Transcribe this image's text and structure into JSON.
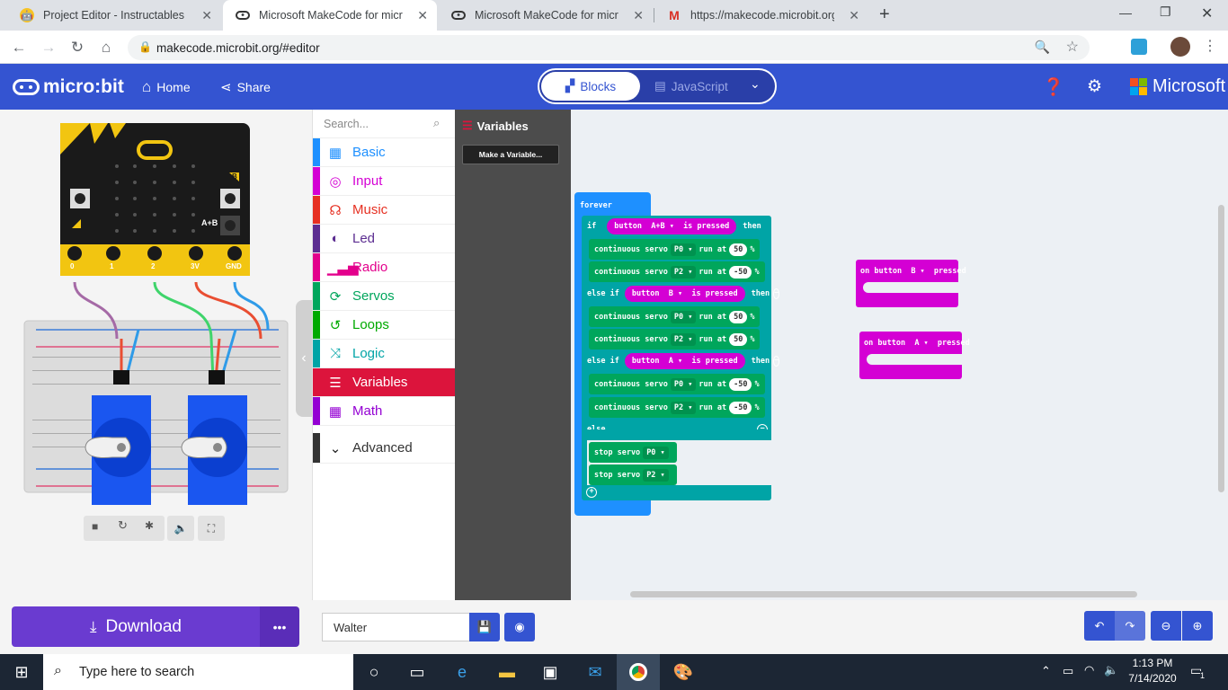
{
  "browser": {
    "tabs": [
      {
        "title": "Project Editor - Instructables",
        "active": false
      },
      {
        "title": "Microsoft MakeCode for micro:bi",
        "active": true
      },
      {
        "title": "Microsoft MakeCode for micro:bi",
        "active": false
      },
      {
        "title": "https://makecode.microbit.org/_l",
        "active": false
      }
    ],
    "url": "makecode.microbit.org/#editor"
  },
  "header": {
    "logo": "micro:bit",
    "home": "Home",
    "share": "Share",
    "blocks": "Blocks",
    "javascript": "JavaScript",
    "brand": "Microsoft"
  },
  "simulator": {
    "pins": [
      "0",
      "1",
      "2",
      "3V",
      "GND"
    ],
    "button_a": "A",
    "button_b": "B",
    "button_ab": "A+B"
  },
  "toolbox": {
    "search_placeholder": "Search...",
    "categories": [
      {
        "label": "Basic",
        "color": "#1e90ff",
        "icon": "grid-icon"
      },
      {
        "label": "Input",
        "color": "#d400d4",
        "icon": "target-icon"
      },
      {
        "label": "Music",
        "color": "#e63022",
        "icon": "headphones-icon"
      },
      {
        "label": "Led",
        "color": "#5c2d91",
        "icon": "toggle-icon"
      },
      {
        "label": "Radio",
        "color": "#e3008c",
        "icon": "signal-icon"
      },
      {
        "label": "Servos",
        "color": "#00a65c",
        "icon": "refresh-icon"
      },
      {
        "label": "Loops",
        "color": "#00aa00",
        "icon": "loop-icon"
      },
      {
        "label": "Logic",
        "color": "#00a4a6",
        "icon": "shuffle-icon"
      },
      {
        "label": "Variables",
        "color": "#dc143c",
        "icon": "list-icon",
        "selected": true
      },
      {
        "label": "Math",
        "color": "#9400d3",
        "icon": "calculator-icon"
      }
    ],
    "advanced": "Advanced"
  },
  "flyout": {
    "title": "Variables",
    "make_variable": "Make a Variable..."
  },
  "blocks": {
    "forever": "forever",
    "if": "if",
    "then": "then",
    "else_if": "else if",
    "else": "else",
    "button": "button",
    "is_pressed": "is pressed",
    "ab": "A+B",
    "a": "A",
    "b": "B",
    "continuous_servo": "continuous servo",
    "run_at": "run at",
    "percent": "%",
    "p0": "P0",
    "p2": "P2",
    "stop_servo": "stop servo",
    "on_button": "on button",
    "pressed": "pressed",
    "v50": "50",
    "vneg50": "-50"
  },
  "bottom": {
    "download": "Download",
    "project_name": "Walter"
  },
  "taskbar": {
    "search": "Type here to search",
    "time": "1:13 PM",
    "date": "7/14/2020",
    "notifications": "1"
  }
}
